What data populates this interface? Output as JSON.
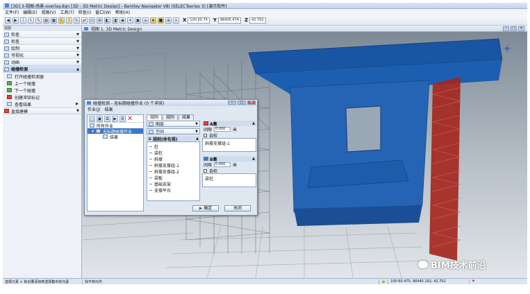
{
  "window": {
    "title": "[3D] 3-视图-场景-overlay.dgn [3D - 3D Metric Design] - Bentley Navigator V8i (SELECTseries 3) [演示软件]"
  },
  "menu": [
    "文件(F)",
    "编辑(E)",
    "视图(V)",
    "工具(T)",
    "检查(I)",
    "窗口(W)",
    "帮助(H)"
  ],
  "toolbar": {
    "x_label": "X",
    "x_value": "100 60 74",
    "y_label": "Y",
    "y_value": "96405.474",
    "z_label": "Z",
    "z_value": "42.702"
  },
  "left_panel": {
    "header": "视图",
    "sections": [
      {
        "label": "检查",
        "icon": "inspect-icon"
      },
      {
        "label": "检查",
        "icon": "check-icon"
      },
      {
        "label": "绘制",
        "icon": "draw-icon"
      },
      {
        "label": "可视化",
        "icon": "visualize-icon"
      },
      {
        "label": "动画",
        "icon": "animation-icon"
      },
      {
        "label": "碰撞检测",
        "icon": "clash-icon"
      }
    ],
    "items": [
      "打开碰撞检测器",
      "上一个碰撞",
      "下一个碰撞",
      "创建冲突标记",
      "查看结果"
    ],
    "bottom_section": "直接建模"
  },
  "view": {
    "title": "视图 1, 3D Metric Design",
    "buttons": [
      "−",
      "□",
      "×"
    ]
  },
  "dialog": {
    "title": "碰撞检测 - 无标题碰撞作业 (0 个冲突)",
    "menu": [
      "作业(J)",
      "结果"
    ],
    "tree": [
      {
        "label": "所有作业",
        "selected": false
      },
      {
        "label": "无标题碰撞作业",
        "selected": true
      },
      {
        "label": "结果",
        "selected": false
      }
    ],
    "tabs": [
      "规则",
      "规则",
      "结果"
    ],
    "dropdown1": "图层",
    "dropdown2": "空间",
    "conditions_header": "规则(命名规)",
    "conditions": [
      "柱",
      "梁柱",
      "斜撑",
      "斜撑支撑组-1",
      "斜撑支撑组-2",
      "梁板",
      "基础支架",
      "支撑平台"
    ],
    "set_a": {
      "label": "A集",
      "gap_label": "间隙",
      "gap_value": "0.000",
      "unit": "米",
      "check_label": "自检",
      "entry": "斜撑支撑组-1"
    },
    "set_b": {
      "label": "B集",
      "gap_label": "间隙",
      "gap_value": "0.000",
      "unit": "米",
      "check_label": "自检",
      "entry": "梁柱"
    },
    "buttons": {
      "ok": "确定",
      "close": "关闭"
    }
  },
  "status": {
    "left": "选择元素 > 标识要添加到选择集中的元素",
    "prompt": "找不到元件",
    "coords": "100 60.475, 96445.162, 42.702"
  },
  "watermark": "BIM技术前沿",
  "colors": {
    "accent": "#3a78c9",
    "model_blue": "#1e5aa8",
    "model_red": "#b3261e"
  }
}
